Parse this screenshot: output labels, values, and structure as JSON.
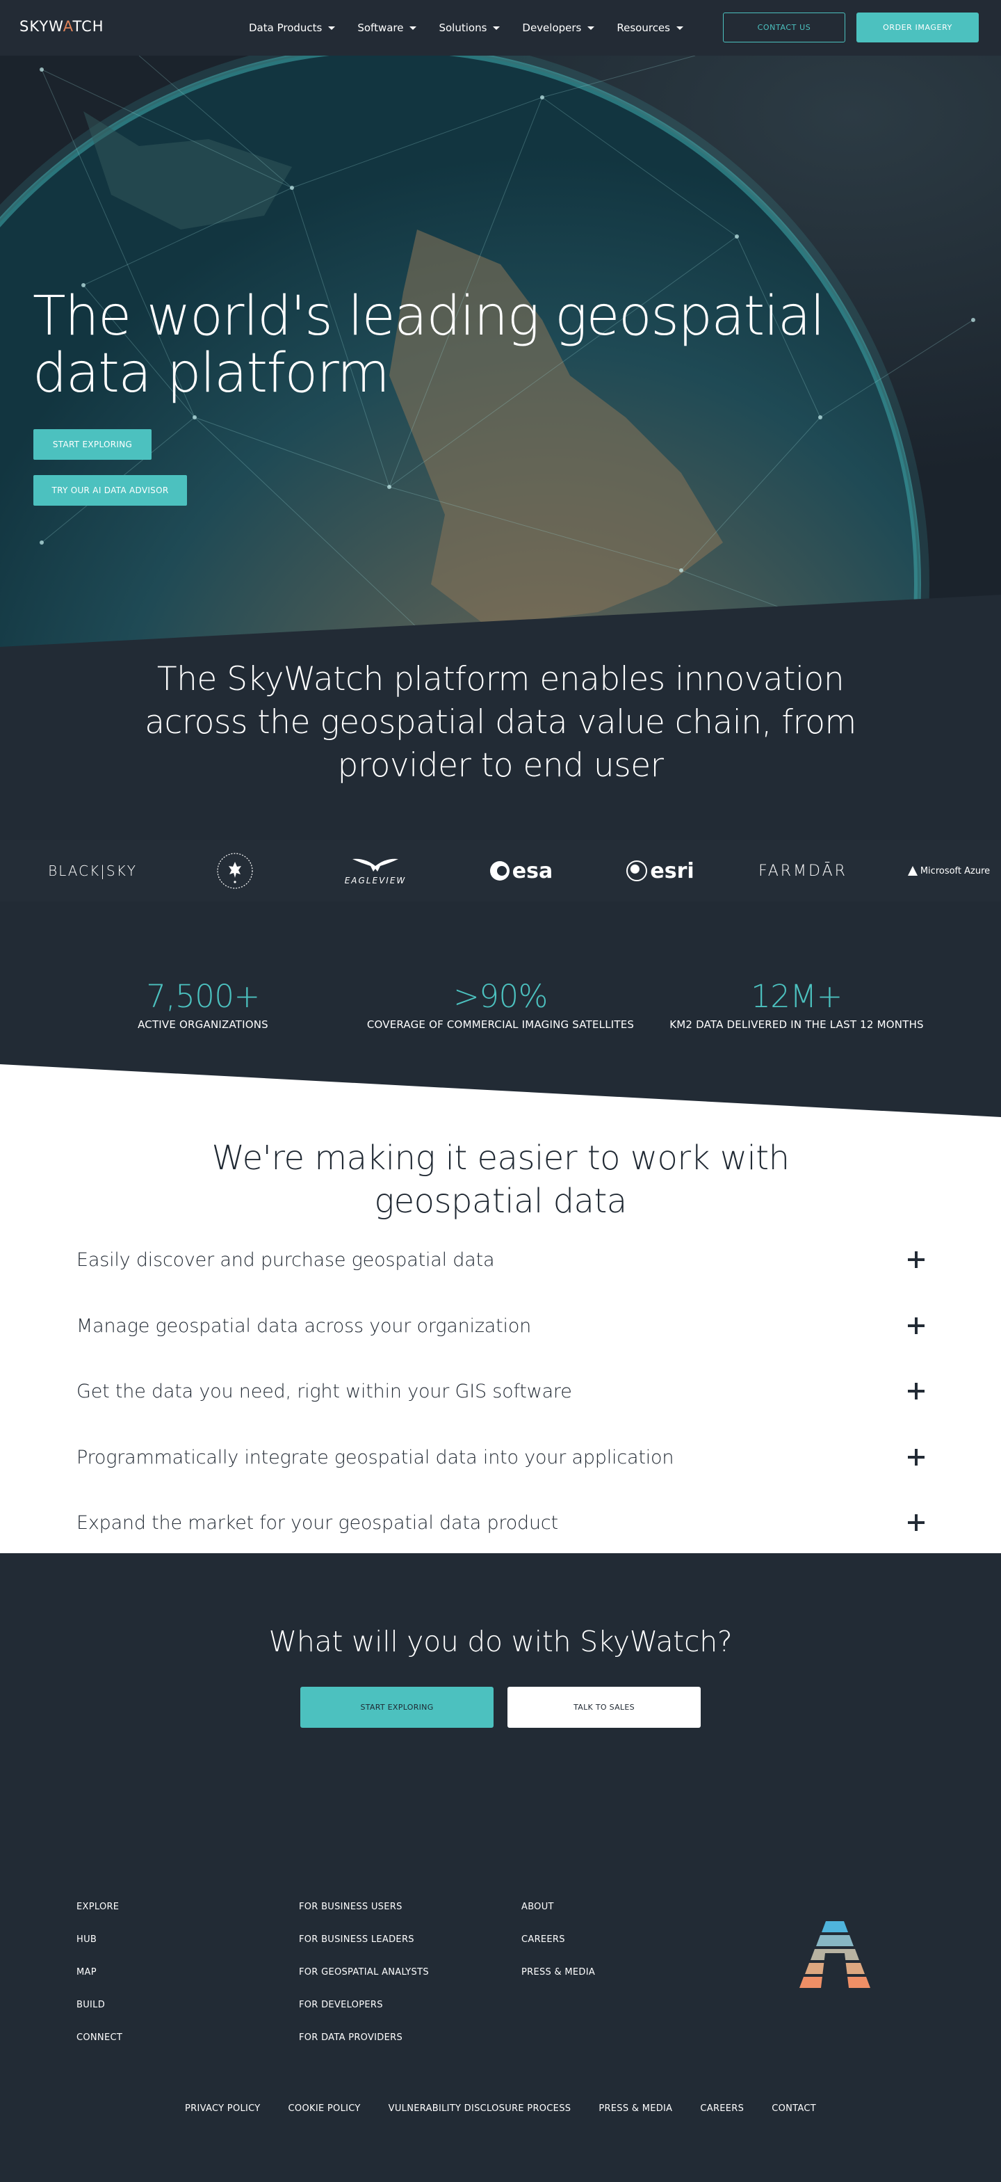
{
  "nav": {
    "logo": {
      "pre": "SKYW",
      "accent": "A",
      "post": "TCH"
    },
    "menu": [
      {
        "label": "Data Products"
      },
      {
        "label": "Software"
      },
      {
        "label": "Solutions"
      },
      {
        "label": "Developers"
      },
      {
        "label": "Resources"
      }
    ],
    "contact_label": "CONTACT US",
    "order_label": "ORDER IMAGERY"
  },
  "hero": {
    "title": "The world's leading geospatial data platform",
    "start_exploring_label": "START EXPLORING",
    "ai_advisor_label": "TRY OUR AI DATA ADVISOR"
  },
  "platform": {
    "title": "The SkyWatch platform enables innovation across the geospatial data value chain, from provider to end user"
  },
  "partners": [
    "BLACK|SKY",
    "CSA",
    "EAGLEVIEW",
    "esa",
    "esri",
    "FARMDĀR",
    "Microsoft Azure"
  ],
  "stats": [
    {
      "value": "7,500+",
      "label": "ACTIVE ORGANIZATIONS"
    },
    {
      "value": ">90%",
      "label": "COVERAGE OF COMMERCIAL IMAGING SATELLITES"
    },
    {
      "value": "12M+",
      "label": "KM2 DATA DELIVERED IN THE LAST 12 MONTHS"
    }
  ],
  "features": {
    "title": "We're making it easier to work with geospatial data",
    "items": [
      {
        "label": "Easily discover and purchase geospatial data"
      },
      {
        "label": "Manage geospatial data across your organization"
      },
      {
        "label": "Get the data you need, right within your GIS software"
      },
      {
        "label": "Programmatically integrate geospatial data into your application"
      },
      {
        "label": "Expand the market for your geospatial data product"
      }
    ]
  },
  "cta": {
    "title": "What will you do with SkyWatch?",
    "start_label": "START EXPLORING",
    "sales_label": "TALK TO SALES"
  },
  "footer": {
    "col1": [
      "EXPLORE",
      "HUB",
      "MAP",
      "BUILD",
      "CONNECT"
    ],
    "col2": [
      "FOR BUSINESS USERS",
      "FOR BUSINESS LEADERS",
      "FOR GEOSPATIAL ANALYSTS",
      "FOR DEVELOPERS",
      "FOR DATA PROVIDERS"
    ],
    "col3": [
      "ABOUT",
      "CAREERS",
      "PRESS & MEDIA"
    ],
    "bottom": [
      "PRIVACY POLICY",
      "COOKIE POLICY",
      "VULNERABILITY DISCLOSURE PROCESS",
      "PRESS & MEDIA",
      "CAREERS",
      "CONTACT"
    ]
  },
  "colors": {
    "accent": "#4cc1bf",
    "navy": "#222b35",
    "logo_accent": "#e0845a"
  }
}
